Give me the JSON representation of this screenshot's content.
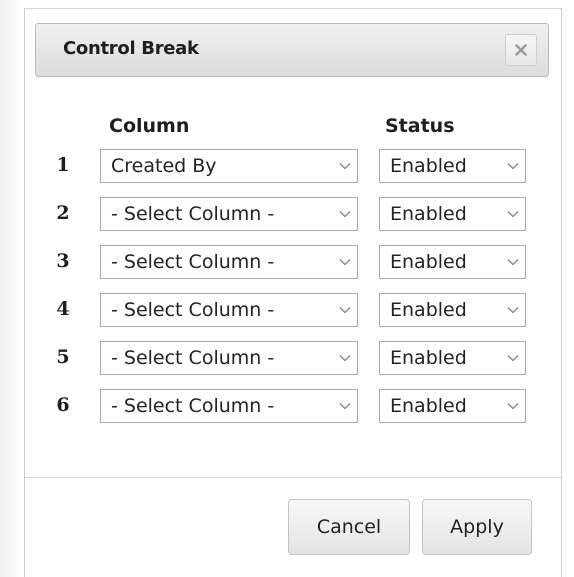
{
  "dialog": {
    "title": "Control Break",
    "close_icon": "close-x-icon"
  },
  "headers": {
    "column": "Column",
    "status": "Status"
  },
  "rows": [
    {
      "number": "1",
      "column": "Created By",
      "status": "Enabled"
    },
    {
      "number": "2",
      "column": "- Select Column -",
      "status": "Enabled"
    },
    {
      "number": "3",
      "column": "- Select Column -",
      "status": "Enabled"
    },
    {
      "number": "4",
      "column": "- Select Column -",
      "status": "Enabled"
    },
    {
      "number": "5",
      "column": "- Select Column -",
      "status": "Enabled"
    },
    {
      "number": "6",
      "column": "- Select Column -",
      "status": "Enabled"
    }
  ],
  "buttons": {
    "cancel": "Cancel",
    "apply": "Apply"
  },
  "colors": {
    "titlebar_bg": "#dcdcdc",
    "border": "#a9a9a9",
    "text": "#1e1e1e"
  }
}
